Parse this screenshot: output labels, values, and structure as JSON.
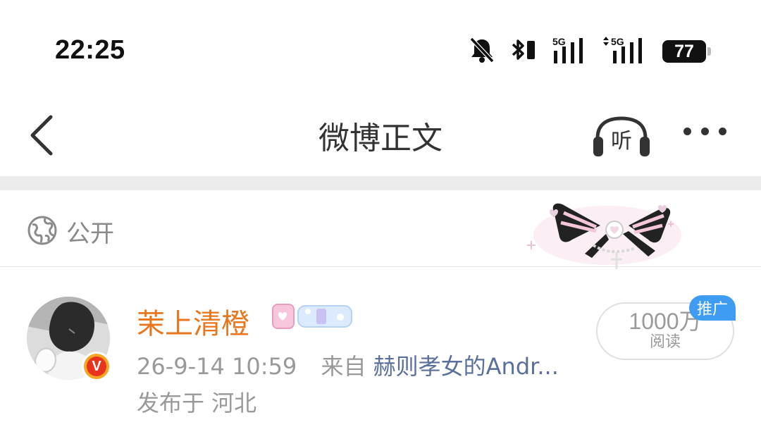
{
  "status_bar": {
    "time": "22:25",
    "battery_level": "77",
    "network_label_1": "5G",
    "network_label_2": "5G",
    "icons": [
      "bell-muted-icon",
      "bluetooth-icon",
      "signal-5g-icon",
      "signal-5g-data-icon",
      "battery-icon"
    ]
  },
  "nav": {
    "title": "微博正文",
    "listen_label": "听",
    "back_icon": "chevron-left-icon",
    "more_icon": "more-dots-icon"
  },
  "visibility": {
    "icon": "globe-icon",
    "label": "公开"
  },
  "post": {
    "username": "茉上清橙",
    "time": "26-9-14 10:59",
    "source_prefix": "来自",
    "source_name": "赫则孝女的Andr...",
    "location": "发布于 河北",
    "verified_badge": "V",
    "read_count": "1000万",
    "read_label": "阅读",
    "promo_tag": "推广"
  },
  "colors": {
    "username": "#e8761c",
    "source_link": "#5a6f9c",
    "promo_tag_bg": "#3e9cf2",
    "verified_badge_outer": "#f5a623",
    "verified_badge_inner": "#e8341c",
    "divider_band": "#ececec"
  }
}
